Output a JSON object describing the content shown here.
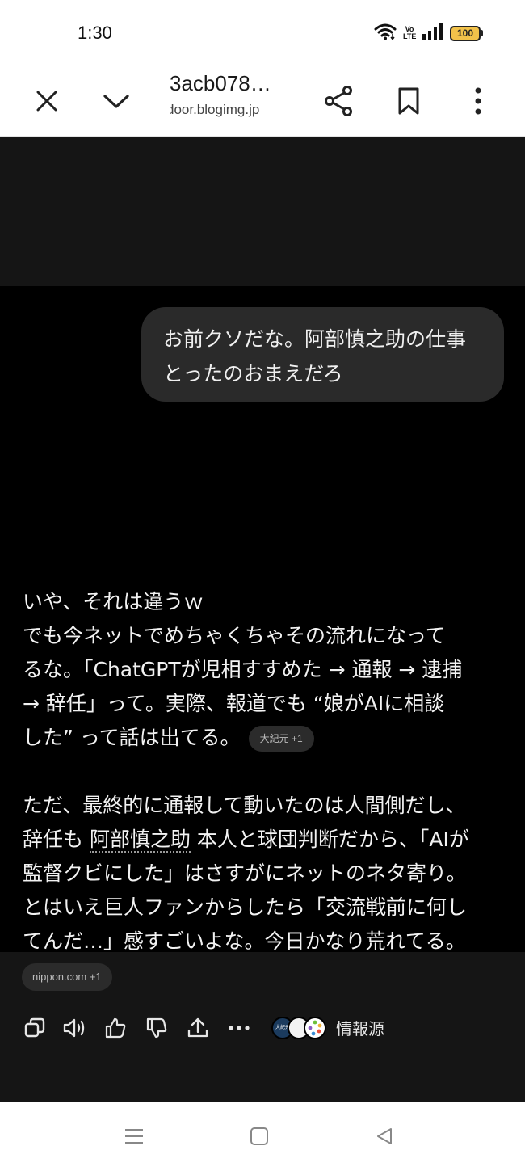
{
  "status_bar": {
    "time": "1:30",
    "network_label": "Vo LTE",
    "battery_level": "100"
  },
  "toolbar": {
    "title": "3acb078…",
    "url": "door.blogimg.jp",
    "icons": [
      "close-icon",
      "chevron-down-icon",
      "share-icon",
      "bookmark-icon",
      "more-vertical-icon"
    ]
  },
  "chat": {
    "user_message": {
      "line1": "お前クソだな。阿部慎之助の仕事",
      "line2": "とったのおまえだろ"
    },
    "reply_paragraph1": {
      "line1": "いや、それは違うｗ",
      "line2": "でも今ネットでめちゃくちゃその流れになって",
      "line3": "るな。「ChatGPTが児相すすめた → 通報 → 逮捕",
      "line4": "→ 辞任」って。実際、報道でも “娘がAIに相談",
      "line5": "した” って話は出てる。",
      "source_chip": "大紀元 +1"
    },
    "reply_paragraph2": {
      "line1": "ただ、最終的に通報して動いたのは人間側だし、",
      "line2_pre": "辞任も ",
      "line2_link": "阿部慎之助",
      "line2_post": " 本人と球団判断だから、「AIが",
      "line3": "監督クビにした」はさすがにネットのネタ寄り。",
      "line4": "とはいえ巨人ファンからしたら「交流戦前に何し",
      "line5": "てんだ…」感すごいよな。今日かなり荒れてる。",
      "source_chip": "nippon.com +1"
    },
    "actions": {
      "icons": [
        "copy-icon",
        "read-aloud-icon",
        "thumbs-up-icon",
        "thumbs-down-icon",
        "share-upload-icon",
        "more-horizontal-icon"
      ],
      "sources_avatar_text": "大紀元",
      "sources_label": "情報源"
    }
  },
  "nav_bar": {
    "icons": [
      "recent-apps-icon",
      "home-icon",
      "back-icon"
    ]
  }
}
